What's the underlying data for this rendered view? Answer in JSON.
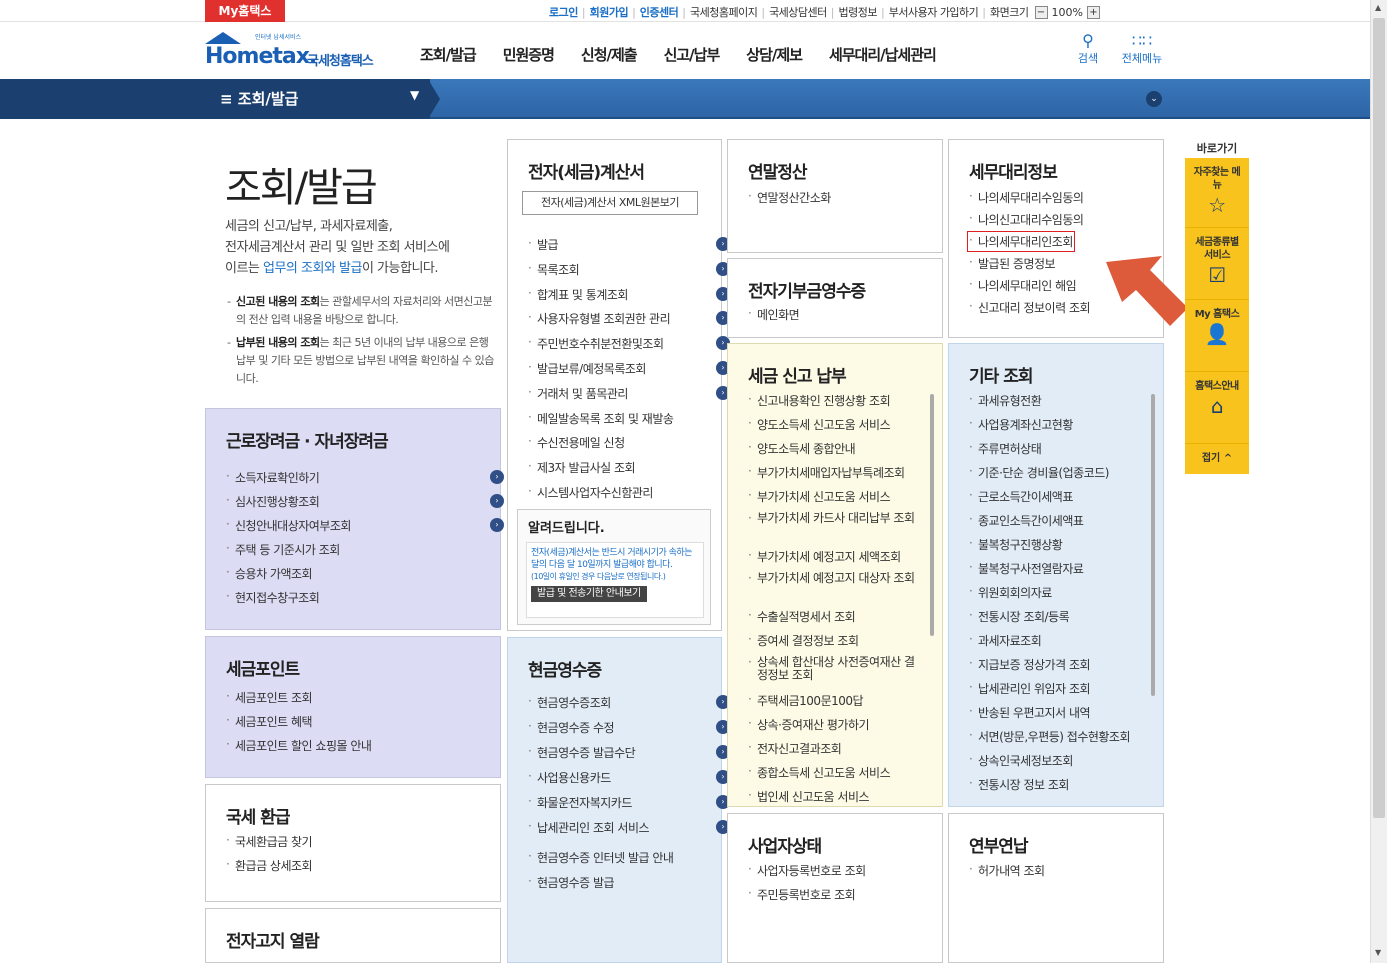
{
  "topbar": {
    "myhometax": "My홈택스",
    "utils": [
      {
        "label": "로그인",
        "bold": true
      },
      {
        "label": "회원가입",
        "bold": true
      },
      {
        "label": "인증센터",
        "bold": true
      },
      {
        "label": "국세청홈페이지",
        "bold": false
      },
      {
        "label": "국세상담센터",
        "bold": false
      },
      {
        "label": "법령정보",
        "bold": false
      },
      {
        "label": "부서사용자 가입하기",
        "bold": false
      },
      {
        "label": "화면크기",
        "bold": false
      }
    ],
    "zoom_minus": "−",
    "zoom_value": "100%",
    "zoom_plus": "+"
  },
  "header": {
    "logo_small": "인터넷 납세서비스",
    "logo_text": "Hometax.",
    "logo_kor": "국세청홈택스",
    "nav": [
      "조회/발급",
      "민원증명",
      "신청/제출",
      "신고/납부",
      "상담/제보",
      "세무대리/납세관리"
    ],
    "search_label": "검색",
    "allmenu_label": "전체메뉴"
  },
  "menubar": {
    "title": "≡  조회/발급"
  },
  "intro": {
    "title": "조회/발급",
    "desc_1": "세금의 신고/납부, 과세자료제출,",
    "desc_2": "전자세금계산서 관리 및 일반 조회 서비스에",
    "desc_3a": "이르는 ",
    "desc_3b": "업무의 조회와 발급",
    "desc_3c": "이 가능합니다.",
    "note1_bold": "신고된 내용의 조회",
    "note1_rest": "는 관할세무서의 자료처리와 서면신고분의 전산 입력 내용을 바탕으로 합니다.",
    "note2_bold": "납부된 내용의 조회",
    "note2_rest": "는 최근 5년 이내의 납부 내용으로 은행 납부 및 기타 모든 방법으로 납부된 내역을 확인하실 수 있습니다."
  },
  "box_work": {
    "title": "근로장려금 · 자녀장려금",
    "items": [
      "소득자료확인하기",
      "심사진행상황조회",
      "신청안내대상자여부조회",
      "주택 등 기준시가 조회",
      "승용차 가액조회",
      "현지접수창구조회"
    ]
  },
  "box_point": {
    "title": "세금포인트",
    "items": [
      "세금포인트 조회",
      "세금포인트 혜택",
      "세금포인트 할인 쇼핑몰 안내"
    ]
  },
  "box_refund": {
    "title": "국세 환급",
    "items": [
      "국세환급금 찾기",
      "환급금 상세조회"
    ]
  },
  "box_ebill": {
    "title": "전자고지 열람"
  },
  "box_einvoice": {
    "title": "전자(세금)계산서",
    "xml_button": "전자(세금)계산서 XML원본보기",
    "items": [
      "발급",
      "목록조회",
      "합계표 및 통계조회",
      "사용자유형별 조회권한 관리",
      "주민번호수취분전환및조회",
      "발급보류/예정목록조회",
      "거래처 및 품목관리",
      "메일발송목록 조회 및 재발송",
      "수신전용메일 신청",
      "제3자 발급사실 조회",
      "시스템사업자수신함관리"
    ],
    "notice_title": "알려드립니다.",
    "notice_text_a": "전자(세금)계산서는 반드시 거래시기가 속하는 달의 다음 달 10일까지 발급해야 합니다.",
    "notice_text_b": "(10일이 휴일인 경우 다음날로 연장됩니다.)",
    "notice_button": "발급 및 전송기한 안내보기"
  },
  "box_cash": {
    "title": "현금영수증",
    "items": [
      "현금영수증조회",
      "현금영수증 수정",
      "현금영수증 발급수단",
      "사업용신용카드",
      "화물운전자복지카드",
      "납세관리인 조회 서비스"
    ],
    "items2": [
      "현금영수증 인터넷 발급 안내",
      "현금영수증 발급"
    ]
  },
  "box_yearend": {
    "title": "연말정산",
    "items": [
      "연말정산간소화"
    ]
  },
  "box_donation": {
    "title": "전자기부금영수증",
    "items": [
      "메인화면"
    ]
  },
  "box_taxreport": {
    "title": "세금 신고 납부",
    "items": [
      "신고내용확인 진행상황 조회",
      "양도소득세 신고도움 서비스",
      "양도소득세 종합안내",
      "부가가치세매입자납부특례조회",
      "부가가치세 신고도움 서비스",
      "부가가치세 카드사 대리납부 조회",
      "부가가치세 예정고지 세액조회",
      "부가가치세 예정고지 대상자 조회",
      "수출실적명세서 조회",
      "증여세 결정정보 조회",
      "상속세 합산대상 사전증여재산 결정정보 조회",
      "주택세금100문100답",
      "상속·증여재산 평가하기",
      "전자신고결과조회",
      "종합소득세 신고도움 서비스",
      "법인세 신고도움 서비스"
    ]
  },
  "box_business": {
    "title": "사업자상태",
    "items": [
      "사업자등록번호로 조회",
      "주민등록번호로 조회"
    ]
  },
  "box_agent": {
    "title": "세무대리정보",
    "items": [
      "나의세무대리수임동의",
      "나의신고대리수임동의",
      "나의세무대리인조회",
      "발급된 증명정보",
      "나의세무대리인 해임",
      "신고대리 정보이력 조회"
    ],
    "highlighted_index": 2
  },
  "box_etc": {
    "title": "기타 조회",
    "items": [
      "과세유형전환",
      "사업용계좌신고현황",
      "주류면허상태",
      "기준·단순 경비율(업종코드)",
      "근로소득간이세액표",
      "종교인소득간이세액표",
      "불복청구진행상황",
      "불복청구사전열람자료",
      "위원회회의자료",
      "전통시장 조회/등록",
      "과세자료조회",
      "지급보증 정상가격 조회",
      "납세관리인 위임자 조회",
      "반송된 우편고지서 내역",
      "서면(방문,우편등) 접수현황조회",
      "상속인국세정보조회",
      "전통시장 정보 조회"
    ]
  },
  "box_license": {
    "title": "연부연납",
    "items": [
      "허가내역 조회"
    ]
  },
  "quick": {
    "title": "바로가기",
    "items": [
      {
        "label": "자주찾는 메뉴",
        "icon": "star-icon",
        "glyph": "☆"
      },
      {
        "label": "세금종류별 서비스",
        "icon": "check-icon",
        "glyph": "☑"
      },
      {
        "label": "My 홈택스",
        "icon": "person-icon",
        "glyph": "👤"
      },
      {
        "label": "홈택스안내",
        "icon": "house-icon",
        "glyph": "⌂"
      }
    ],
    "fold": "접기 ^"
  },
  "colors": {
    "accent": "#1a6fc6",
    "nav_bar": "#2d65a6",
    "highlight": "#e02020",
    "arrow": "#dd5a3a",
    "quick": "#f7c31c"
  }
}
